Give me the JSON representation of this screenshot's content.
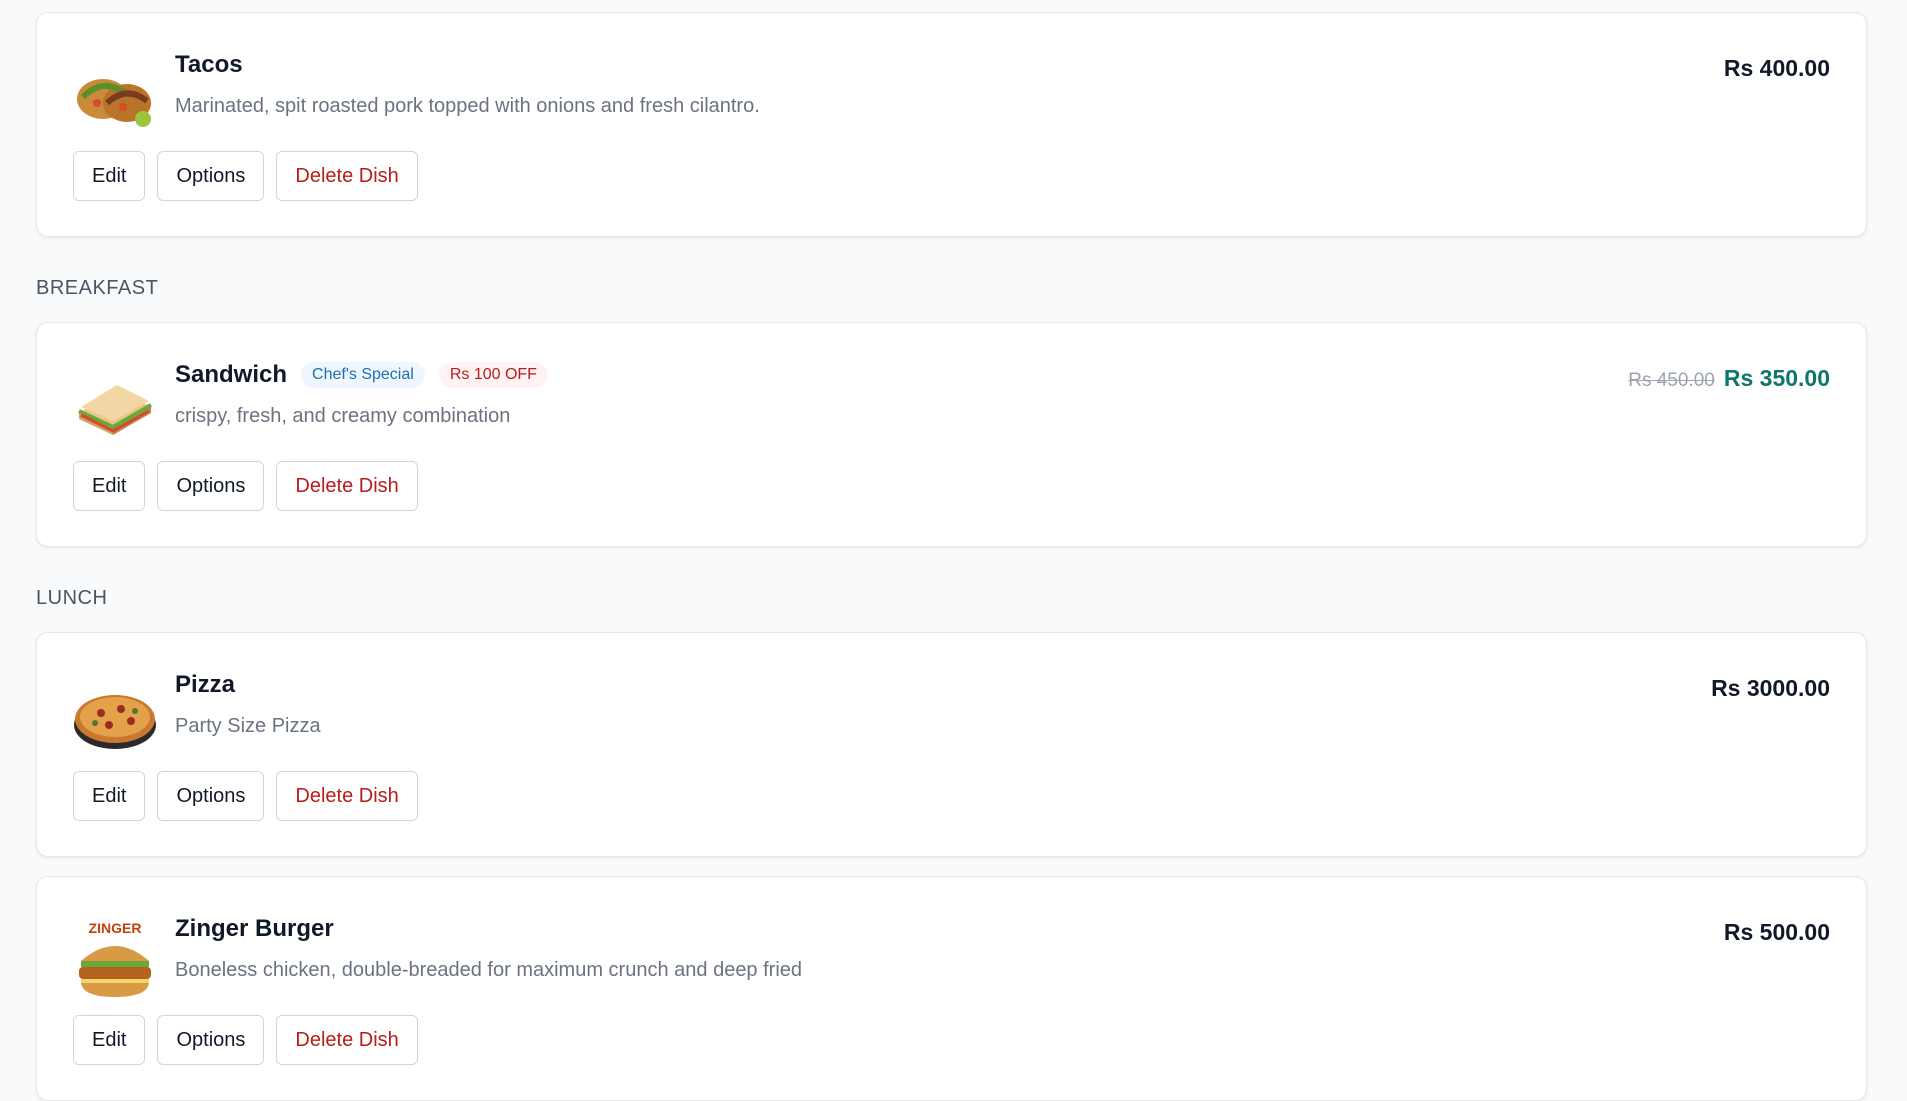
{
  "sections": [
    {
      "label": ""
    },
    {
      "label": "BREAKFAST"
    },
    {
      "label": "LUNCH"
    }
  ],
  "dishes": [
    {
      "name": "Tacos",
      "description": "Marinated, spit roasted pork topped with onions and fresh cilantro.",
      "price": "Rs 400.00",
      "image_icon": "tacos-image"
    },
    {
      "name": "Sandwich",
      "description": "crispy, fresh, and creamy combination",
      "badges": [
        "Chef's Special",
        "Rs 100 OFF"
      ],
      "old_price": "Rs 450.00",
      "price": "Rs 350.00",
      "image_icon": "sandwich-image"
    },
    {
      "name": "Pizza",
      "description": "Party Size Pizza",
      "price": "Rs 3000.00",
      "image_icon": "pizza-image"
    },
    {
      "name": "Zinger Burger",
      "description": "Boneless chicken, double-breaded for maximum crunch and deep fried",
      "price": "Rs 500.00",
      "image_icon": "burger-image",
      "image_logo_text": "ZINGER"
    }
  ],
  "actions": {
    "edit": "Edit",
    "options": "Options",
    "delete": "Delete Dish"
  },
  "colors": {
    "danger": "#b91c1c",
    "sale_price": "#0f766e",
    "badge_special": "#1e6fb0"
  }
}
